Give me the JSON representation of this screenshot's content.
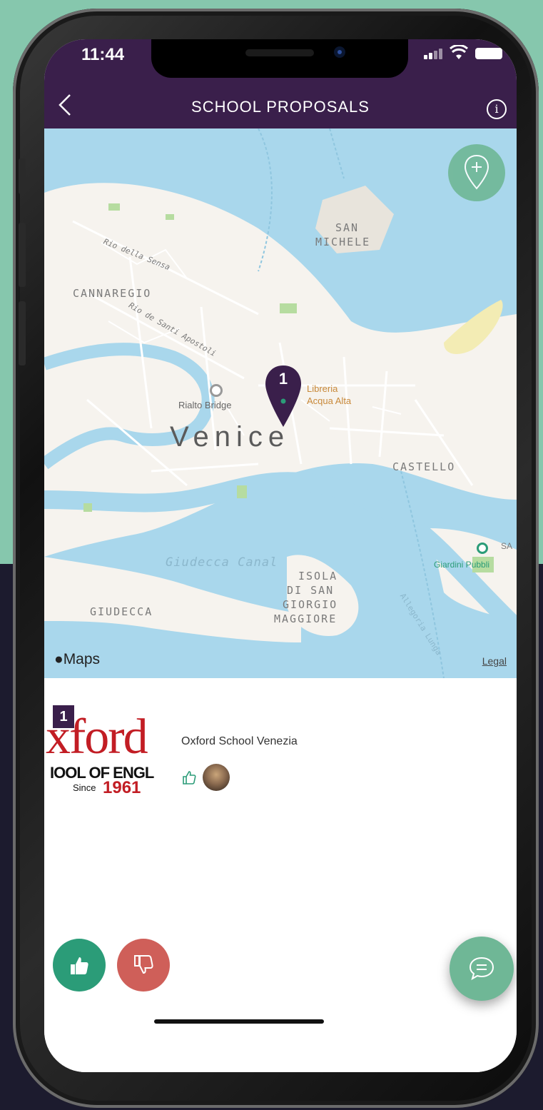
{
  "status": {
    "time": "11:44"
  },
  "nav": {
    "title": "SCHOOL PROPOSALS",
    "back_icon": "chevron-left-icon",
    "info_icon": "info-icon",
    "info_glyph": "i"
  },
  "map": {
    "city": "Venice",
    "labels": {
      "san_michele_1": "SAN",
      "san_michele_2": "MICHELE",
      "cannaregio": "CANNAREGIO",
      "castello": "CASTELLO",
      "giudecca": "GIUDECCA",
      "isola_1": "ISOLA",
      "isola_2": "DI SAN",
      "isola_3": "GIORGIO",
      "isola_4": "MAGGIORE",
      "rio_sensa": "Rio della Sensa",
      "rio_apostoli": "Rio de Santi Apostoli",
      "giudecca_canal": "Giudecca Canal",
      "allegoria": "Allegoria Lunga"
    },
    "pois": {
      "rialto": "Rialto Bridge",
      "libreria_1": "Libreria",
      "libreria_2": "Acqua Alta",
      "giardini": "Giardini Pubbli",
      "sa": "SA"
    },
    "pin_number": "1",
    "attribution": "Maps",
    "legal": "Legal",
    "water_color": "#a9d7ec",
    "land_color": "#f6f3ee",
    "pin_color": "#3a1f4b"
  },
  "proposal": {
    "rank": "1",
    "name": "Oxford School Venezia",
    "logo_text_1": "xford",
    "logo_text_2": "IOOL OF ENGL",
    "logo_since": "Since",
    "logo_year": "1961"
  },
  "actions": {
    "like_icon": "thumbs-up-icon",
    "dislike_icon": "thumbs-down-icon",
    "chat_icon": "chat-icon"
  },
  "colors": {
    "brand": "#3a1f4b",
    "like": "#2b9c78",
    "dislike": "#cf5f59",
    "accent": "#6fb796"
  }
}
